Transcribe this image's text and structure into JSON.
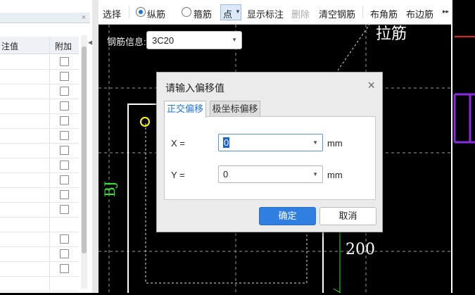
{
  "left_panel": {
    "close_glyph": "×",
    "col_value": "注值",
    "col_attach": "附加",
    "collapse_arrow": "◀",
    "rows": [
      {
        "checkbox": true
      },
      {
        "checkbox": true
      },
      {
        "checkbox": true
      },
      {
        "checkbox": true
      },
      {
        "checkbox": true
      },
      {
        "checkbox": true
      },
      {
        "checkbox": true
      },
      {
        "checkbox": true
      },
      {
        "checkbox": true
      },
      {
        "checkbox": true
      },
      {
        "checkbox": true
      },
      {
        "checkbox": false
      },
      {
        "checkbox": true
      },
      {
        "checkbox": true
      },
      {
        "checkbox": true
      },
      {
        "checkbox": false
      }
    ]
  },
  "toolbar": {
    "select": "选择",
    "longitudinal": "纵筋",
    "stirrup": "箍筋",
    "point_mode": "点",
    "show_labels": "显示标注",
    "delete": "删除",
    "clear_rebar": "清空钢筋",
    "corner_rebar": "布角筋",
    "side_rebar": "布边筋",
    "more": "▸▸"
  },
  "canvas": {
    "rebar_info_label": "钢筋信息:",
    "rebar_info_value": "3C20",
    "text_top": "拉筋",
    "text_bj": "BJ",
    "text_dim": "200"
  },
  "dialog": {
    "title": "请输入偏移值",
    "close": "×",
    "tab_orthogonal": "正交偏移",
    "tab_polar": "极坐标偏移",
    "x_label": "X =",
    "x_value": "0",
    "y_label": "Y =",
    "y_value": "0",
    "unit": "mm",
    "ok": "确定",
    "cancel": "取消"
  },
  "colors": {
    "canvas_bg": "#000000",
    "accent_blue": "#2f7fe0",
    "green_text": "#2ee82e",
    "yellow_marker": "#ffff00",
    "purple_lines": "#8a2be2",
    "red_line": "#e0202a"
  }
}
